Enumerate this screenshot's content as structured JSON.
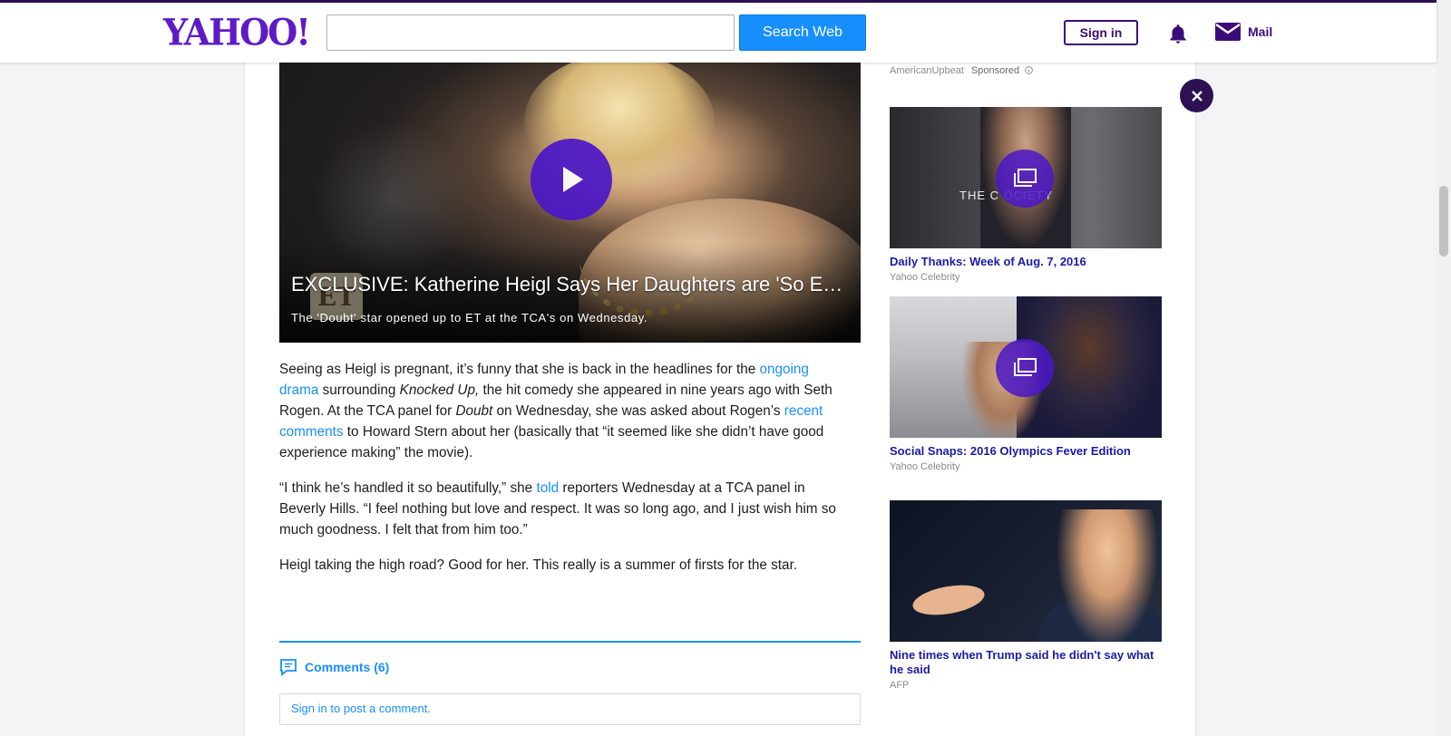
{
  "header": {
    "logo": "YAHOO!",
    "search_placeholder": "",
    "search_button": "Search Web",
    "signin_button": "Sign in",
    "mail_label": "Mail"
  },
  "video": {
    "badge": "ET",
    "title": "EXCLUSIVE: Katherine Heigl Says Her Daughters are 'So Excited' About New Baby",
    "caption": "The 'Doubt' star opened up to ET at the TCA's on Wednesday."
  },
  "article": {
    "p1": {
      "t1": "Seeing as Heigl is pregnant, it’s funny that she is back in the headlines for the ",
      "link1": "ongoing drama",
      "t2": " surrounding ",
      "em1": "Knocked Up,",
      "t3": " the hit comedy she appeared in nine years ago with Seth Rogen. At the TCA panel for ",
      "em2": "Doubt",
      "t4": " on Wednesday, she was asked about Rogen’s ",
      "link2": "recent comments",
      "t5": " to Howard Stern about her (basically that “it seemed like she didn’t have good experience making” the movie)."
    },
    "p2": {
      "t1": "“I think he’s handled it so beautifully,” she ",
      "link1": "told",
      "t2": " reporters Wednesday at a TCA panel in Beverly Hills. “I feel nothing but love and respect. It was so long ago, and I just wish him so much goodness. I felt that from him too.”"
    },
    "p3": "Heigl taking the high road? Good for her. This really is a summer of firsts for the star."
  },
  "comments": {
    "label": "Comments (6)",
    "prompt": "Sign in to post a comment."
  },
  "sidebar": {
    "sponsor_source": "AmericanUpbeat",
    "sponsor_label": "Sponsored",
    "cards": [
      {
        "thumb_text": "THE C    OCIETY",
        "title": "Daily Thanks: Week of Aug. 7, 2016",
        "source": "Yahoo Celebrity"
      },
      {
        "title": "Social Snaps: 2016 Olympics Fever Edition",
        "source": "Yahoo Celebrity"
      },
      {
        "title": "Nine times when Trump said he didn't say what he said",
        "source": "AFP"
      }
    ]
  },
  "colors": {
    "brand_purple": "#5f1ac8",
    "link_blue": "#188fff",
    "header_border": "#2d1152"
  }
}
